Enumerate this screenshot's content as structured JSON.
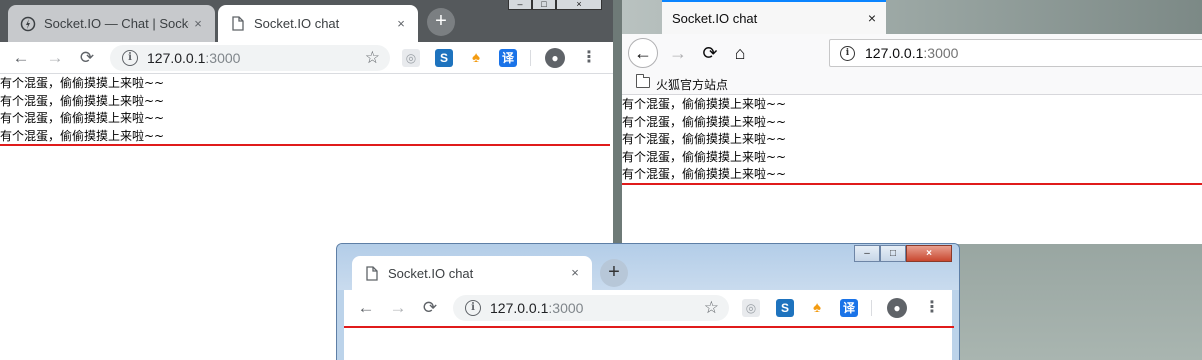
{
  "chrome_left": {
    "tabs": [
      {
        "title": "Socket.IO — Chat | Socket",
        "close": "×",
        "state": "inactive"
      },
      {
        "title": "Socket.IO chat",
        "close": "×",
        "state": "active"
      }
    ],
    "new_tab": "+",
    "window_controls": [
      "–",
      "□",
      "×"
    ],
    "url_host": "127.0.0.1",
    "url_port": ":3000",
    "messages": [
      "有个混蛋，偷偷摸摸上来啦~~",
      "有个混蛋，偷偷摸摸上来啦~~",
      "有个混蛋，偷偷摸摸上来啦~~",
      "有个混蛋，偷偷摸摸上来啦~~"
    ]
  },
  "firefox_right": {
    "tab_title": "Socket.IO chat",
    "tab_close": "×",
    "url_host": "127.0.0.1",
    "url_port": ":3000",
    "bookmark_label": "火狐官方站点",
    "messages": [
      "有个混蛋，偷偷摸摸上来啦~~",
      "有个混蛋，偷偷摸摸上来啦~~",
      "有个混蛋，偷偷摸摸上来啦~~",
      "有个混蛋，偷偷摸摸上来啦~~",
      "有个混蛋，偷偷摸摸上来啦~~"
    ]
  },
  "chrome_bottom": {
    "tab_title": "Socket.IO chat",
    "tab_close": "×",
    "new_tab": "+",
    "window_controls": [
      "–",
      "□",
      "×"
    ],
    "url_host": "127.0.0.1",
    "url_port": ":3000",
    "messages": []
  },
  "icons": {
    "back": "←",
    "forward": "→",
    "reload": "⟳",
    "home": "⌂",
    "star": "☆",
    "menu": "⋮",
    "info": "i",
    "ext_s": "S",
    "ext_trans": "译",
    "ext_mascot": "♠",
    "ext_grey": "◎",
    "avatar": "●"
  },
  "colors": {
    "accent_red": "#e01b1b",
    "firefox_blue": "#0a84ff"
  }
}
